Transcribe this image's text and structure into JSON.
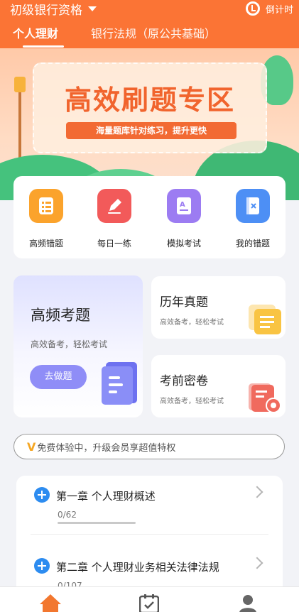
{
  "header": {
    "title": "初级银行资格",
    "timer_label": "倒计时",
    "tabs": [
      {
        "label": "个人理财",
        "active": true
      },
      {
        "label": "银行法规（原公共基础）",
        "active": false
      }
    ],
    "color": "#fb7435"
  },
  "banner": {
    "title": "高效刷题专区",
    "subtitle": "海量题库针对练习，提升更快"
  },
  "quick_actions": [
    {
      "label": "高频错题",
      "icon": "list-icon",
      "color": "#fba32c"
    },
    {
      "label": "每日一练",
      "icon": "pencil-icon",
      "color": "#f25a5a"
    },
    {
      "label": "模拟考试",
      "icon": "exam-icon",
      "color": "#9c7cf2"
    },
    {
      "label": "我的错题",
      "icon": "wrong-book-icon",
      "color": "#4d8ff5"
    }
  ],
  "cards": {
    "frequent": {
      "title": "高频考题",
      "subtitle": "高效备考，轻松考试",
      "button": "去做题"
    },
    "past": {
      "title": "历年真题",
      "subtitle": "高效备考，轻松考试"
    },
    "secret": {
      "title": "考前密卷",
      "subtitle": "高效备考，轻松考试"
    }
  },
  "vip": {
    "mark": "V",
    "text": "免费体验中，升级会员享超值特权"
  },
  "chapters": [
    {
      "title": "第一章 个人理财概述",
      "progress": "0/62",
      "done": 0,
      "total": 62
    },
    {
      "title": "第二章 个人理财业务相关法律法规",
      "progress": "0/107",
      "done": 0,
      "total": 107
    }
  ],
  "bottom_nav": [
    {
      "icon": "home-icon",
      "active": true
    },
    {
      "icon": "calendar-icon",
      "active": false
    },
    {
      "icon": "user-icon",
      "active": false
    }
  ]
}
